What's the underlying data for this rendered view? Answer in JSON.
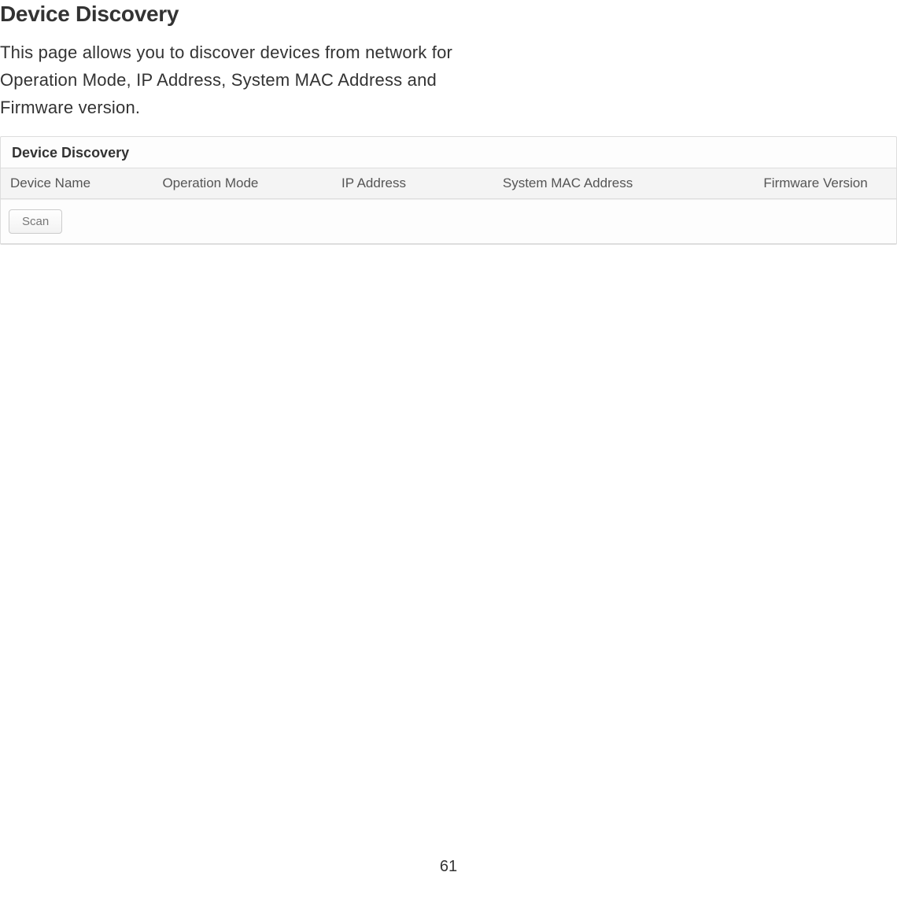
{
  "heading": "Device Discovery",
  "description": "This page allows you to discover devices from network for Operation Mode, IP Address, System MAC Address and Firmware version.",
  "panel": {
    "title": "Device Discovery",
    "columns": [
      "Device Name",
      "Operation Mode",
      "IP Address",
      "System MAC Address",
      "Firmware Version"
    ],
    "scan_label": "Scan"
  },
  "page_number": "61"
}
